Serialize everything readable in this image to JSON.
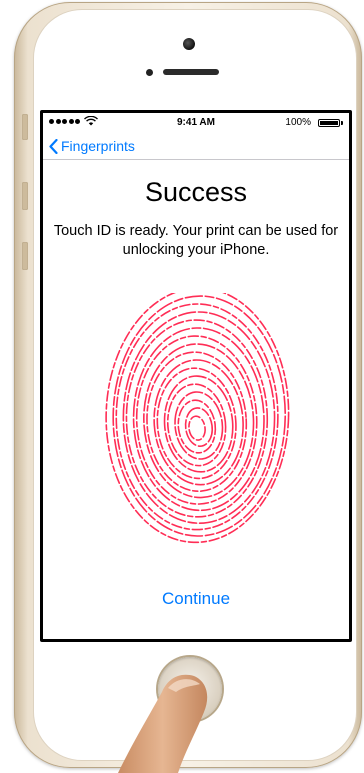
{
  "status_bar": {
    "time": "9:41 AM",
    "battery_percent": "100%"
  },
  "nav": {
    "back_label": "Fingerprints"
  },
  "content": {
    "title": "Success",
    "message": "Touch ID is ready. Your print can be used for unlocking your iPhone."
  },
  "actions": {
    "continue_label": "Continue"
  },
  "colors": {
    "accent": "#007aff",
    "fingerprint": "#ff2d55",
    "device_gold": "#e9dcc6"
  },
  "icons": [
    "signal-dots-icon",
    "wifi-icon",
    "battery-icon",
    "chevron-left-icon",
    "fingerprint-icon"
  ]
}
